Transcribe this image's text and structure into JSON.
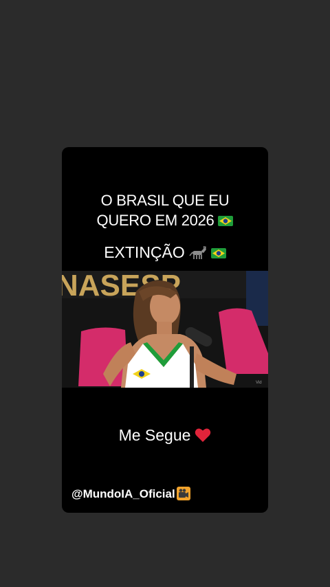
{
  "post": {
    "title_line1": "O BRASIL QUE EU",
    "title_line2": "QUERO EM 2026",
    "title_icon": "brazil-flag-icon",
    "subtitle": "EXTINÇÃO",
    "subtitle_icons": [
      "donkey-icon",
      "brazil-flag-icon"
    ],
    "video_background_text": "NASESP",
    "video_watermark": "Vid",
    "call_to_action": "Me Segue",
    "cta_icon": "red-heart-icon",
    "handle": "@MundoIA_Oficial",
    "handle_icon": "movie-camera-icon"
  },
  "colors": {
    "page_background": "#2b2b2b",
    "card_background": "#000000",
    "text": "#ffffff",
    "chair_pink": "#d42c6a",
    "heart_red": "#e0243a",
    "flag_green": "#1f9d3a",
    "flag_yellow": "#f2d21b",
    "flag_blue": "#1d3f8f"
  }
}
